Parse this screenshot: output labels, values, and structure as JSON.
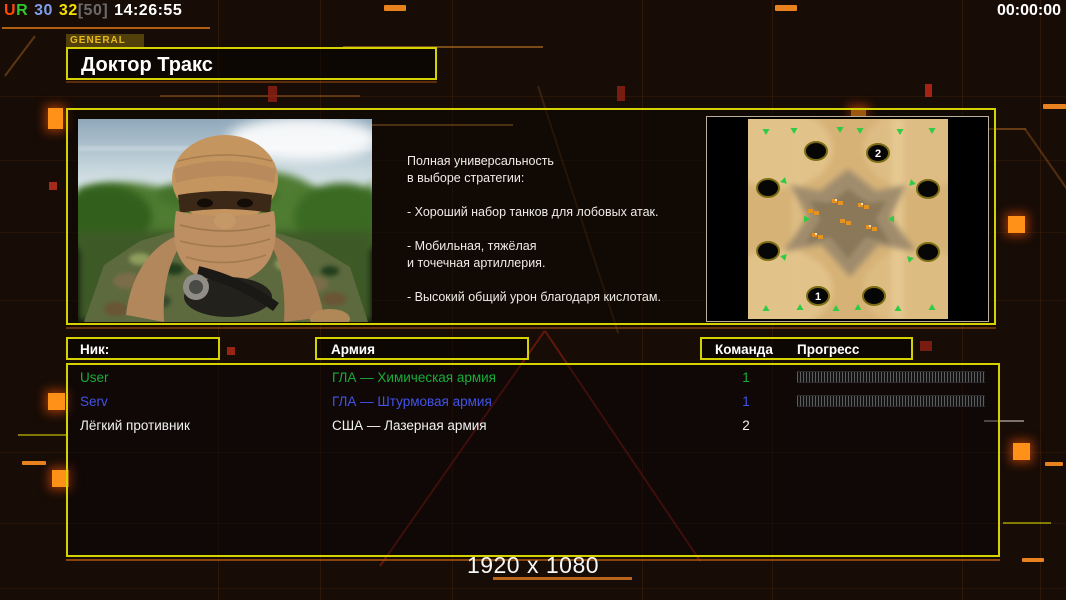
{
  "status_bar": {
    "segments": [
      {
        "text": "U",
        "color": "#ff4a00"
      },
      {
        "text": "R",
        "color": "#2ec82e"
      },
      {
        "text": "30",
        "color": "#7e9eea"
      },
      {
        "text": "32",
        "color": "#f2e000"
      },
      {
        "text": "[50]",
        "color": "#6a6a6a"
      },
      {
        "text": "14:26:55",
        "color": "#ffffff"
      }
    ],
    "match_timer": "00:00:00"
  },
  "general_panel": {
    "tab_label": "GENERAL",
    "title": "Доктор Тракс",
    "description_lines": [
      "Полная универсальность",
      "в выборе стратегии:",
      "",
      "- Хороший набор танков для лобовых атак.",
      "",
      "- Мобильная, тяжёлая",
      "и точечная артиллерия.",
      "",
      "- Высокий общий урон благодаря кислотам."
    ]
  },
  "map_preview": {
    "markers": [
      "1",
      "2"
    ]
  },
  "lobby_table": {
    "headers": {
      "nick": "Ник:",
      "army": "Армия",
      "team": "Команда",
      "progress": "Прогресс"
    },
    "rows": [
      {
        "nick": "User",
        "army": "ГЛА — Химическая армия",
        "team": "1",
        "color": "#17ad38",
        "loading": true
      },
      {
        "nick": "Serv",
        "army": "ГЛА — Штурмовая армия",
        "team": "1",
        "color": "#4253e8",
        "loading": true
      },
      {
        "nick": "Лёгкий противник",
        "army": "США — Лазерная армия",
        "team": "2",
        "color": "#f2f2f2",
        "loading": false
      }
    ]
  },
  "footer": {
    "resolution": "1920 x 1080"
  },
  "colors": {
    "accent_yellow": "#d6d200",
    "accent_orange": "#e8821e",
    "underline_orange": "#8a4410",
    "map_border_gray": "#b8b098",
    "progress_tick": "#5e5e5e"
  }
}
